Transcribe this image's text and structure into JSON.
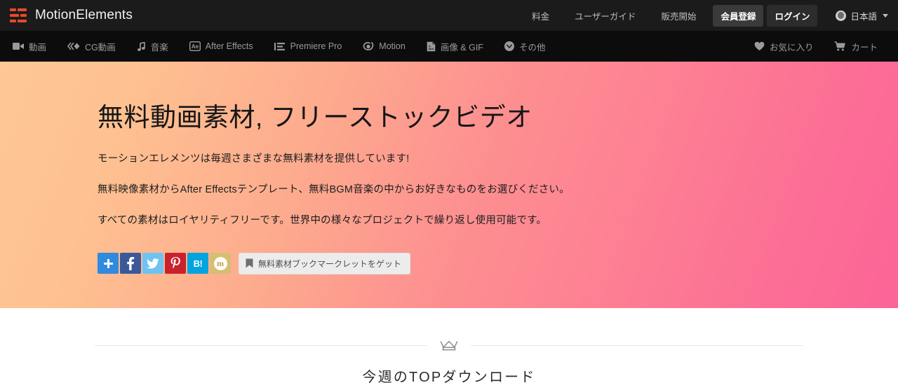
{
  "brand": {
    "name": "MotionElements",
    "mark_color": "#e8492b"
  },
  "topbar": {
    "links": [
      {
        "label": "料金",
        "name": "topnav-pricing"
      },
      {
        "label": "ユーザーガイド",
        "name": "topnav-user-guide"
      },
      {
        "label": "販売開始",
        "name": "topnav-start-selling"
      }
    ],
    "signup_label": "会員登録",
    "login_label": "ログイン",
    "language_label": "日本語"
  },
  "mainnav": {
    "items": [
      {
        "label": "動画",
        "icon": "video-camera-icon",
        "name": "nav-video"
      },
      {
        "label": "CG動画",
        "icon": "cg-diamond-icon",
        "name": "nav-cg-video"
      },
      {
        "label": "音楽",
        "icon": "music-note-icon",
        "name": "nav-music"
      },
      {
        "label": "After Effects",
        "icon": "after-effects-icon",
        "name": "nav-after-effects"
      },
      {
        "label": "Premiere Pro",
        "icon": "premiere-pro-icon",
        "name": "nav-premiere-pro"
      },
      {
        "label": "Motion",
        "icon": "motion-swirl-icon",
        "name": "nav-motion"
      },
      {
        "label": "画像 & GIF",
        "icon": "image-file-icon",
        "name": "nav-image-gif"
      },
      {
        "label": "その他",
        "icon": "chevron-down-circle-icon",
        "name": "nav-more"
      }
    ],
    "favorites_label": "お気に入り",
    "cart_label": "カート"
  },
  "hero": {
    "heading": "無料動画素材, フリーストックビデオ",
    "paragraph1": "モーションエレメンツは毎週さまざまな無料素材を提供しています!",
    "paragraph2": "無料映像素材からAfter Effectsテンプレート、無料BGM音楽の中からお好きなものをお選びください。",
    "paragraph3": "すべての素材はロイヤリティフリーです。世界中の様々なプロジェクトで繰り返し使用可能です。",
    "gradient_start": "#fec795",
    "gradient_end": "#fb6497",
    "share_buttons": [
      {
        "name": "share-addthis-button",
        "glyph": "+",
        "color": "#2f8ae0"
      },
      {
        "name": "share-facebook-button",
        "glyph": "f",
        "color": "#3b5998"
      },
      {
        "name": "share-twitter-button",
        "glyph": "bird",
        "color": "#6fc3f2"
      },
      {
        "name": "share-pinterest-button",
        "glyph": "P",
        "color": "#c8232c"
      },
      {
        "name": "share-hatena-button",
        "glyph": "B!",
        "color": "#00a4de"
      },
      {
        "name": "share-mixi-button",
        "glyph": "m",
        "color": "#d6be72"
      }
    ],
    "bookmarklet_label": "無料素材ブックマークレットをゲット"
  },
  "section": {
    "title": "今週のTOPダウンロード",
    "icon": "crown-icon"
  }
}
